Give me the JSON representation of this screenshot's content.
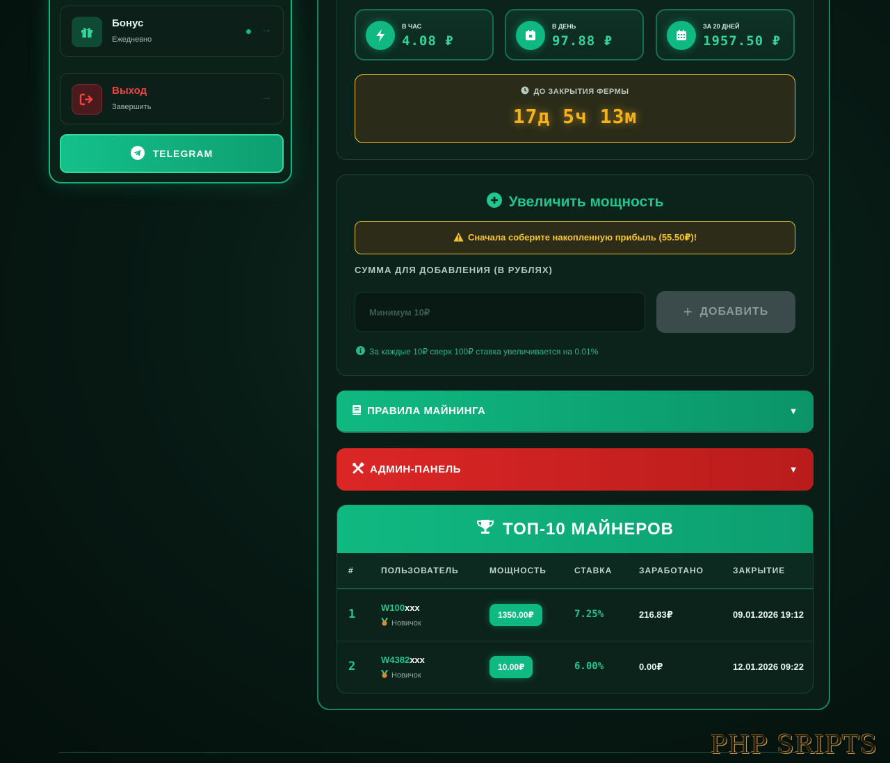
{
  "sidebar": {
    "bonus": {
      "title": "Бонус",
      "subtitle": "Ежедневно",
      "arrow": "→",
      "icon": "gift-icon"
    },
    "logout": {
      "title": "Выход",
      "subtitle": "Завершить",
      "arrow": "→",
      "icon": "logout-icon"
    },
    "telegram": {
      "label": "TELEGRAM",
      "icon": "telegram-icon"
    }
  },
  "earnings": {
    "per_hour": {
      "label": "В ЧАС",
      "value": "4.08 ₽",
      "icon": "lightning-icon"
    },
    "per_day": {
      "label": "В ДЕНЬ",
      "value": "97.88 ₽",
      "icon": "calendar-day-icon"
    },
    "per_20_days": {
      "label": "ЗА 20 ДНЕЙ",
      "value": "1957.50 ₽",
      "icon": "calendar-month-icon"
    }
  },
  "farm_close": {
    "label": "ДО ЗАКРЫТИЯ ФЕРМЫ",
    "value": "17д 5ч 13м",
    "icon": "clock-icon"
  },
  "power": {
    "title": "Увеличить мощность",
    "warning": "Сначала соберите накопленную прибыль (55.50₽)!",
    "amount_label": "СУММА ДЛЯ ДОБАВЛЕНИЯ (В РУБЛЯХ)",
    "input_placeholder": "Минимум 10₽",
    "input_value": "",
    "add_label": "ДОБАВИТЬ",
    "add_icon_glyph": "+",
    "note": "За каждые 10₽ сверх 100₽ ставка увеличивается на 0.01%"
  },
  "accordions": {
    "rules": {
      "label": "ПРАВИЛА МАЙНИНГА",
      "caret": "▼"
    },
    "admin": {
      "label": "АДМИН-ПАНЕЛЬ",
      "caret": "▼"
    }
  },
  "top_miners": {
    "title": "ТОП-10 МАЙНЕРОВ",
    "columns": [
      "#",
      "ПОЛЬЗОВАТЕЛЬ",
      "МОЩНОСТЬ",
      "СТАВКА",
      "ЗАРАБОТАНО",
      "ЗАКРЫТИЕ"
    ],
    "rows": [
      {
        "rank": "1",
        "name": "W100",
        "mask": "xxx",
        "level": "Новичок",
        "power": "1350.00₽",
        "rate": "7.25%",
        "earned": "216.83₽",
        "closing": "09.01.2026 19:12"
      },
      {
        "rank": "2",
        "name": "W4382",
        "mask": "xxx",
        "level": "Новичок",
        "power": "10.00₽",
        "rate": "6.00%",
        "earned": "0.00₽",
        "closing": "12.01.2026 09:22"
      }
    ]
  },
  "watermark": "PHP SRIPTS",
  "colors": {
    "accent": "#10b981",
    "danger": "#dc2626",
    "warning": "#f3c631",
    "background": "#071813"
  }
}
